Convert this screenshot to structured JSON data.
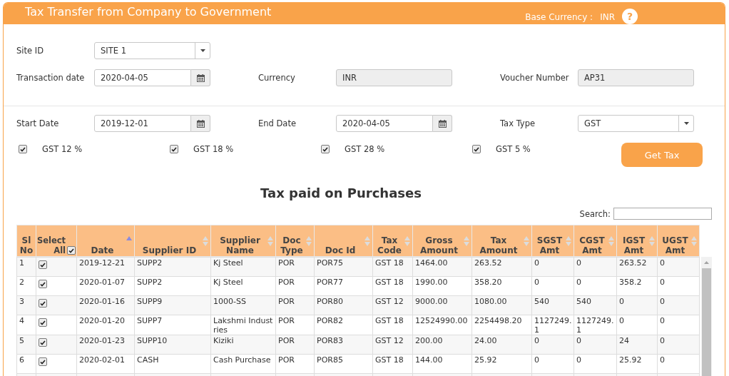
{
  "header": {
    "title": "Tax Transfer from Company to Government",
    "base_currency_label": "Base Currency :",
    "base_currency": "INR",
    "help_label": "?"
  },
  "form_rows": [
    {
      "fields": [
        {
          "kind": "select",
          "label": "Site ID",
          "value": "SITE 1",
          "disabled": false
        }
      ]
    },
    {
      "fields": [
        {
          "kind": "date",
          "label": "Transaction date",
          "value": "2020-04-05",
          "disabled": false
        },
        {
          "kind": "text",
          "label": "Currency",
          "value": "INR",
          "disabled": true
        },
        {
          "kind": "text",
          "label": "Voucher Number",
          "value": "AP31",
          "disabled": true
        }
      ]
    }
  ],
  "filter_fields": [
    {
      "kind": "date",
      "label": "Start Date",
      "value": "2019-12-01",
      "disabled": false
    },
    {
      "kind": "date",
      "label": "End Date",
      "value": "2020-04-05",
      "disabled": false
    },
    {
      "kind": "select",
      "label": "Tax Type",
      "value": "GST",
      "disabled": false
    }
  ],
  "tax_options": [
    {
      "label": "GST 12 %",
      "checked": true
    },
    {
      "label": "GST 18 %",
      "checked": true
    },
    {
      "label": "GST 28 %",
      "checked": true
    },
    {
      "label": "GST 5 %",
      "checked": true
    }
  ],
  "get_tax_button": "Get Tax",
  "table": {
    "title": "Tax paid on Purchases",
    "search_label": "Search:",
    "columns": [
      {
        "kind": "text",
        "label": "Sl No",
        "sortable": false,
        "sort_ascending": false
      },
      {
        "kind": "checkbox",
        "label": "Select All",
        "checked": true,
        "sortable": false,
        "sort_ascending": false
      },
      {
        "kind": "text",
        "label": "Date",
        "sortable": true,
        "sort_ascending": true
      },
      {
        "kind": "text",
        "label": "Supplier ID",
        "sortable": true,
        "sort_ascending": false
      },
      {
        "kind": "text",
        "label": "Supplier Name",
        "sortable": true,
        "sort_ascending": false
      },
      {
        "kind": "text",
        "label": "Doc Type",
        "sortable": true,
        "sort_ascending": false
      },
      {
        "kind": "text",
        "label": "Doc Id",
        "sortable": true,
        "sort_ascending": false
      },
      {
        "kind": "text",
        "label": "Tax Code",
        "sortable": true,
        "sort_ascending": false
      },
      {
        "kind": "text",
        "label": "Gross Amount",
        "sortable": true,
        "sort_ascending": false
      },
      {
        "kind": "text",
        "label": "Tax Amount",
        "sortable": true,
        "sort_ascending": false
      },
      {
        "kind": "text",
        "label": "SGST Amt",
        "sortable": true,
        "sort_ascending": false
      },
      {
        "kind": "text",
        "label": "CGST Amt",
        "sortable": true,
        "sort_ascending": false
      },
      {
        "kind": "text",
        "label": "IGST Amt",
        "sortable": true,
        "sort_ascending": false
      },
      {
        "kind": "text",
        "label": "UGST Amt",
        "sortable": true,
        "sort_ascending": false
      }
    ],
    "rows": [
      {
        "checked": true,
        "cells": [
          "1",
          "",
          "2019-12-21",
          "SUPP2",
          "Kj Steel",
          "POR",
          "POR75",
          "GST 18",
          "1464.00",
          "263.52",
          "0",
          "0",
          "263.52",
          "0"
        ]
      },
      {
        "checked": true,
        "cells": [
          "2",
          "",
          "2020-01-07",
          "SUPP2",
          "Kj Steel",
          "POR",
          "POR77",
          "GST 18",
          "1990.00",
          "358.20",
          "0",
          "0",
          "358.2",
          "0"
        ]
      },
      {
        "checked": true,
        "cells": [
          "3",
          "",
          "2020-01-16",
          "SUPP9",
          "1000-SS",
          "POR",
          "POR80",
          "GST 12",
          "9000.00",
          "1080.00",
          "540",
          "540",
          "0",
          "0"
        ]
      },
      {
        "checked": true,
        "cells": [
          "4",
          "",
          "2020-01-20",
          "SUPP7",
          "Lakshmi Industries",
          "POR",
          "POR82",
          "GST 18",
          "12524990.00",
          "2254498.20",
          "1127249.1",
          "1127249.1",
          "0",
          "0"
        ]
      },
      {
        "checked": true,
        "cells": [
          "5",
          "",
          "2020-01-23",
          "SUPP10",
          "Kiziki",
          "POR",
          "POR83",
          "GST 12",
          "200.00",
          "24.00",
          "0",
          "0",
          "24",
          "0"
        ]
      },
      {
        "checked": true,
        "cells": [
          "6",
          "",
          "2020-02-01",
          "CASH",
          "Cash Purchase",
          "POR",
          "POR85",
          "GST 18",
          "144.00",
          "25.92",
          "0",
          "0",
          "25.92",
          "0"
        ]
      }
    ]
  }
}
